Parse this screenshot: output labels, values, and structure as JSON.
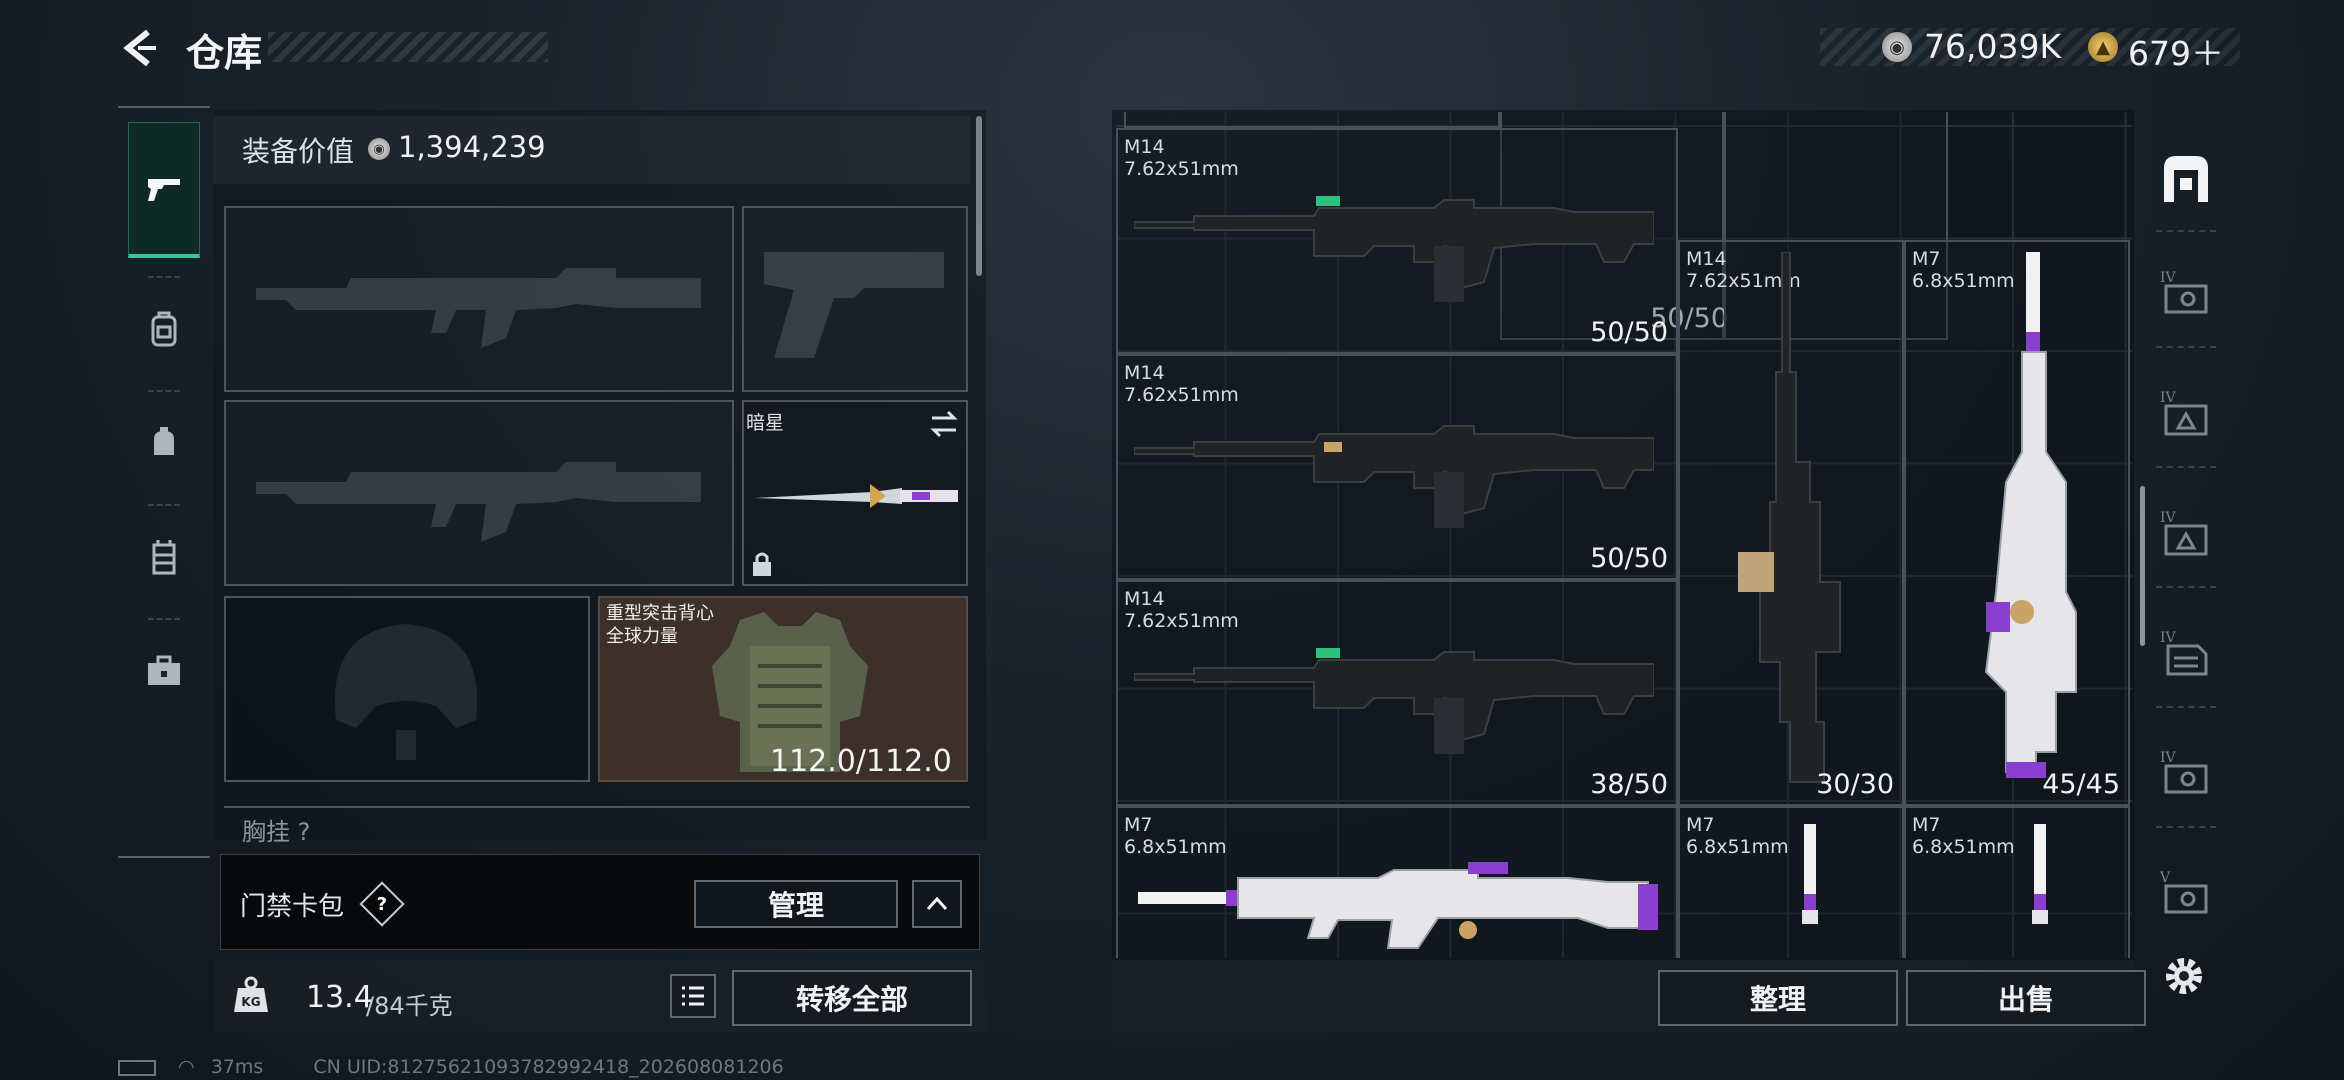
{
  "header": {
    "title": "仓库",
    "currency_primary": "76,039K",
    "currency_secondary": "679＋"
  },
  "sidebar": {
    "tabs": [
      {
        "name": "weapon",
        "icon": "pistol-icon",
        "active": true
      },
      {
        "name": "backpack-1",
        "icon": "backpack-icon"
      },
      {
        "name": "backpack-2",
        "icon": "pouch-icon"
      },
      {
        "name": "vest",
        "icon": "rig-icon"
      },
      {
        "name": "case",
        "icon": "toolbox-icon"
      }
    ]
  },
  "equipment": {
    "value_label": "装备价值",
    "value": "1,394,239",
    "melee_name": "暗星",
    "armor_name_line1": "重型突击背心",
    "armor_name_line2": "全球力量",
    "armor_durability": "112.0/112.0",
    "chest_rig_label": "胸挂 ?"
  },
  "keycard": {
    "label": "门禁卡包",
    "help": "?",
    "manage_label": "管理"
  },
  "weight": {
    "current": "13.4",
    "max": "/84千克",
    "kg_icon": "KG",
    "transfer_label": "转移全部"
  },
  "status": {
    "ping": "37ms",
    "uid": "CN UID:812756210937829924​18_202608081206"
  },
  "storage": {
    "items": [
      {
        "name": "M14",
        "caliber": "7.62x51mm",
        "ammo": "50/50"
      },
      {
        "name": "M14",
        "caliber": "7.62x51mm",
        "ammo": "50/50"
      },
      {
        "name": "M14",
        "caliber": "7.62x51mm",
        "ammo": "38/50"
      },
      {
        "name": "M14",
        "caliber": "7.62x51mm",
        "ammo": "30/30"
      },
      {
        "name": "M7",
        "caliber": "6.8x51mm",
        "ammo": "45/45"
      },
      {
        "name": "M7",
        "caliber": "6.8x51mm",
        "ammo": ""
      },
      {
        "name": "M7",
        "caliber": "6.8x51mm",
        "ammo": ""
      },
      {
        "name": "M7",
        "caliber": "6.8x51mm",
        "ammo": ""
      }
    ],
    "top_partial_ammo": "50/50",
    "sort_label": "整理",
    "sell_label": "出售"
  },
  "right_rail": {
    "icons": [
      "safe-box-icon",
      "tier-4-keycard-icon",
      "tier-4-armor-icon",
      "tier-4-armor-icon-2",
      "tier-4-document-icon",
      "tier-4-keycard-icon-2",
      "tier-5-keycard-icon"
    ],
    "tier_labels": [
      "IV",
      "IV",
      "IV",
      "IV",
      "IV",
      "V"
    ]
  },
  "colors": {
    "accent": "#35c79a",
    "armor_slot": "#3d302b",
    "purple": "#8a3fd0"
  }
}
